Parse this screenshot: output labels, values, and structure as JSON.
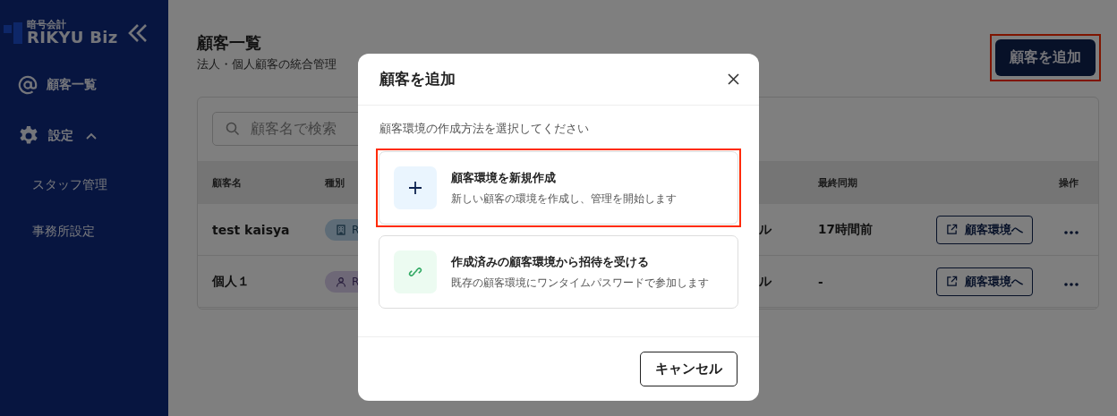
{
  "sidebar": {
    "logo": {
      "subtitle": "暗号会計",
      "name": "RIKYU Biz"
    },
    "items": [
      {
        "label": "顧客一覧",
        "kind": "customers"
      },
      {
        "label": "設定",
        "kind": "settings",
        "expanded": true,
        "children": [
          {
            "label": "スタッフ管理"
          },
          {
            "label": "事務所設定"
          }
        ]
      }
    ]
  },
  "page": {
    "title": "顧客一覧",
    "subtitle": "法人・個人顧客の統合管理",
    "add_button": {
      "label": "顧客を追加",
      "highlighted": true
    },
    "search": {
      "placeholder": "顧客名で検索"
    },
    "table": {
      "columns": [
        "顧客名",
        "種別",
        "最終同期",
        "操作"
      ],
      "rows": [
        {
          "name": "test kaisya",
          "type": {
            "kind": "corporate",
            "label": "R"
          },
          "column_3": "ル",
          "last_sync": "17時間前",
          "action": "顧客環境へ"
        },
        {
          "name": "個人１",
          "type": {
            "kind": "individual",
            "label": "R"
          },
          "column_3": "ル",
          "last_sync": "-",
          "action": "顧客環境へ"
        }
      ]
    }
  },
  "dialog": {
    "title": "顧客を追加",
    "message": "顧客環境の作成方法を選択してください",
    "options": [
      {
        "kind": "create",
        "title": "顧客環境を新規作成",
        "description": "新しい顧客の環境を作成し、管理を開始します",
        "highlighted": true
      },
      {
        "kind": "invite",
        "title": "作成済みの顧客環境から招待を受ける",
        "description": "既存の顧客環境にワンタイムパスワードで参加します",
        "highlighted": false
      }
    ],
    "cancel_button": "キャンセル"
  }
}
